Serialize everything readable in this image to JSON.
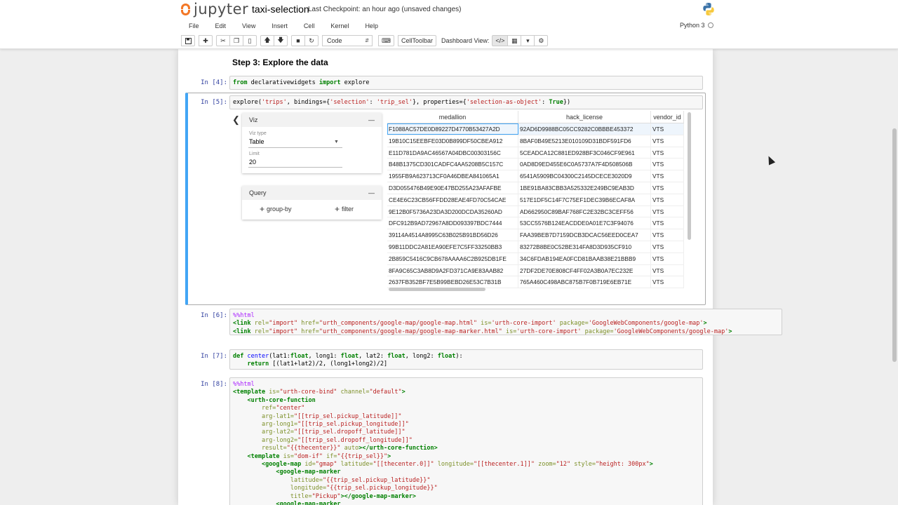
{
  "header": {
    "logo_text": "jupyter",
    "notebook_name": "taxi-selection",
    "checkpoint": "Last Checkpoint: an hour ago (unsaved changes)",
    "kernel": "Python 3"
  },
  "menu": [
    "File",
    "Edit",
    "View",
    "Insert",
    "Cell",
    "Kernel",
    "Help"
  ],
  "toolbar": {
    "cell_type": "Code",
    "celltoolbar_label": "CellToolbar",
    "dashboard_label": "Dashboard View:"
  },
  "notebook": {
    "heading": "Step 3: Explore the data",
    "cells": {
      "c4": {
        "prompt": "In [4]:"
      },
      "c5": {
        "prompt": "In [5]:"
      },
      "c6": {
        "prompt": "In [6]:"
      },
      "c7": {
        "prompt": "In [7]:"
      },
      "c8": {
        "prompt": "In [8]:"
      }
    }
  },
  "explore": {
    "viz_panel": {
      "title": "Viz",
      "collapse": "—",
      "viz_type_label": "Viz type",
      "viz_type_value": "Table",
      "limit_label": "Limit",
      "limit_value": "20"
    },
    "query_panel": {
      "title": "Query",
      "collapse": "—",
      "group_by": "group-by",
      "filter": "filter"
    },
    "columns": [
      "medallion",
      "hack_license",
      "vendor_id"
    ],
    "rows": [
      [
        "F1088AC57DE0D89227D4770B53427A2D",
        "92AD6D9988BC05CC9282C0BBBE453372",
        "VTS"
      ],
      [
        "19B10C15EEBFE03D0B899DF50CBEA912",
        "8BAF0B49E5213E010109D31BDF591FD6",
        "VTS"
      ],
      [
        "E11D781DA9AC46567A04DBC00303156C",
        "5CEADCA12C881ED928BF3C046CF9E961",
        "VTS"
      ],
      [
        "B48B1375CD301CADFC4AA5208B5C157C",
        "0AD8D9ED455E6C0A5737A7F4D508506B",
        "VTS"
      ],
      [
        "1955FB9A623713CF0A46DBEA841065A1",
        "6541A5909BC04300C2145DCECE3020D9",
        "VTS"
      ],
      [
        "D3D055476B49E90E47BD255A23AFAFBE",
        "1BE91BA83CBB3A525332E249BC9EAB3D",
        "VTS"
      ],
      [
        "CE4E6C23CB56FFDD28EAE4FD70C54CAE",
        "517E1DF5C14F7C75EF1DEC39B6ECAF8A",
        "VTS"
      ],
      [
        "9E12B0F5736A23DA3D200DCDA35260AD",
        "AD662950C89BAF768FC2E32BC3CEFF56",
        "VTS"
      ],
      [
        "DFC912B9AD72967A8DD093397BDC7444",
        "53CC5576B124EACDDE0A01E7C3F94076",
        "VTS"
      ],
      [
        "39114A4514A8995C63B025B91BD56D26",
        "FAA39BEB7D7159DCB3DCAC56EED0CEA7",
        "VTS"
      ],
      [
        "99B11DDC2A81EA90EFE7C5FF33250BB3",
        "83272B8BE0C52BE314FA8D3D935CF910",
        "VTS"
      ],
      [
        "2B859C5416C9CB678AAAA6C2B925DB1FE",
        "34C6FDAB194EA0FCD81BAAB38E21BBB9",
        "VTS"
      ],
      [
        "8FA9C65C3AB8D9A2FD371CA9E83AAB82",
        "27DF2DE70E808CF4FF02A3B0A7EC232E",
        "VTS"
      ],
      [
        "2637FB352BF7E5B99BEBD26E53C7B31B",
        "765A460C498ABC875B7F0B719E6EB71E",
        "VTS"
      ]
    ]
  }
}
